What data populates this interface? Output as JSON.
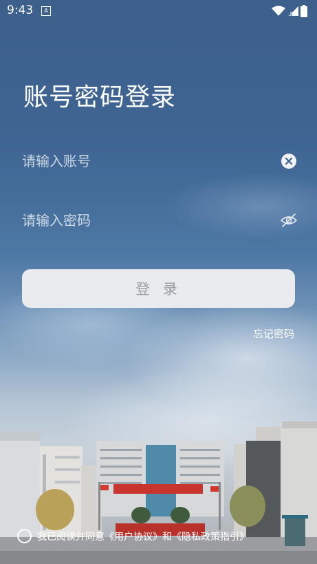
{
  "status_bar": {
    "time": "9:43",
    "notification": "A"
  },
  "login": {
    "title": "账号密码登录",
    "account_placeholder": "请输入账号",
    "password_placeholder": "请输入密码",
    "login_button": "登 录",
    "forgot_password": "忘记密码"
  },
  "agreement": {
    "text_prefix": "我已阅读并同意",
    "user_agreement": "《用户协议》",
    "conjunction": "和",
    "privacy_policy": "《隐私政策指引》"
  },
  "colors": {
    "button_bg": "#eaebef",
    "button_text": "#9a9ca3",
    "sky_top": "#3d5f8c"
  }
}
